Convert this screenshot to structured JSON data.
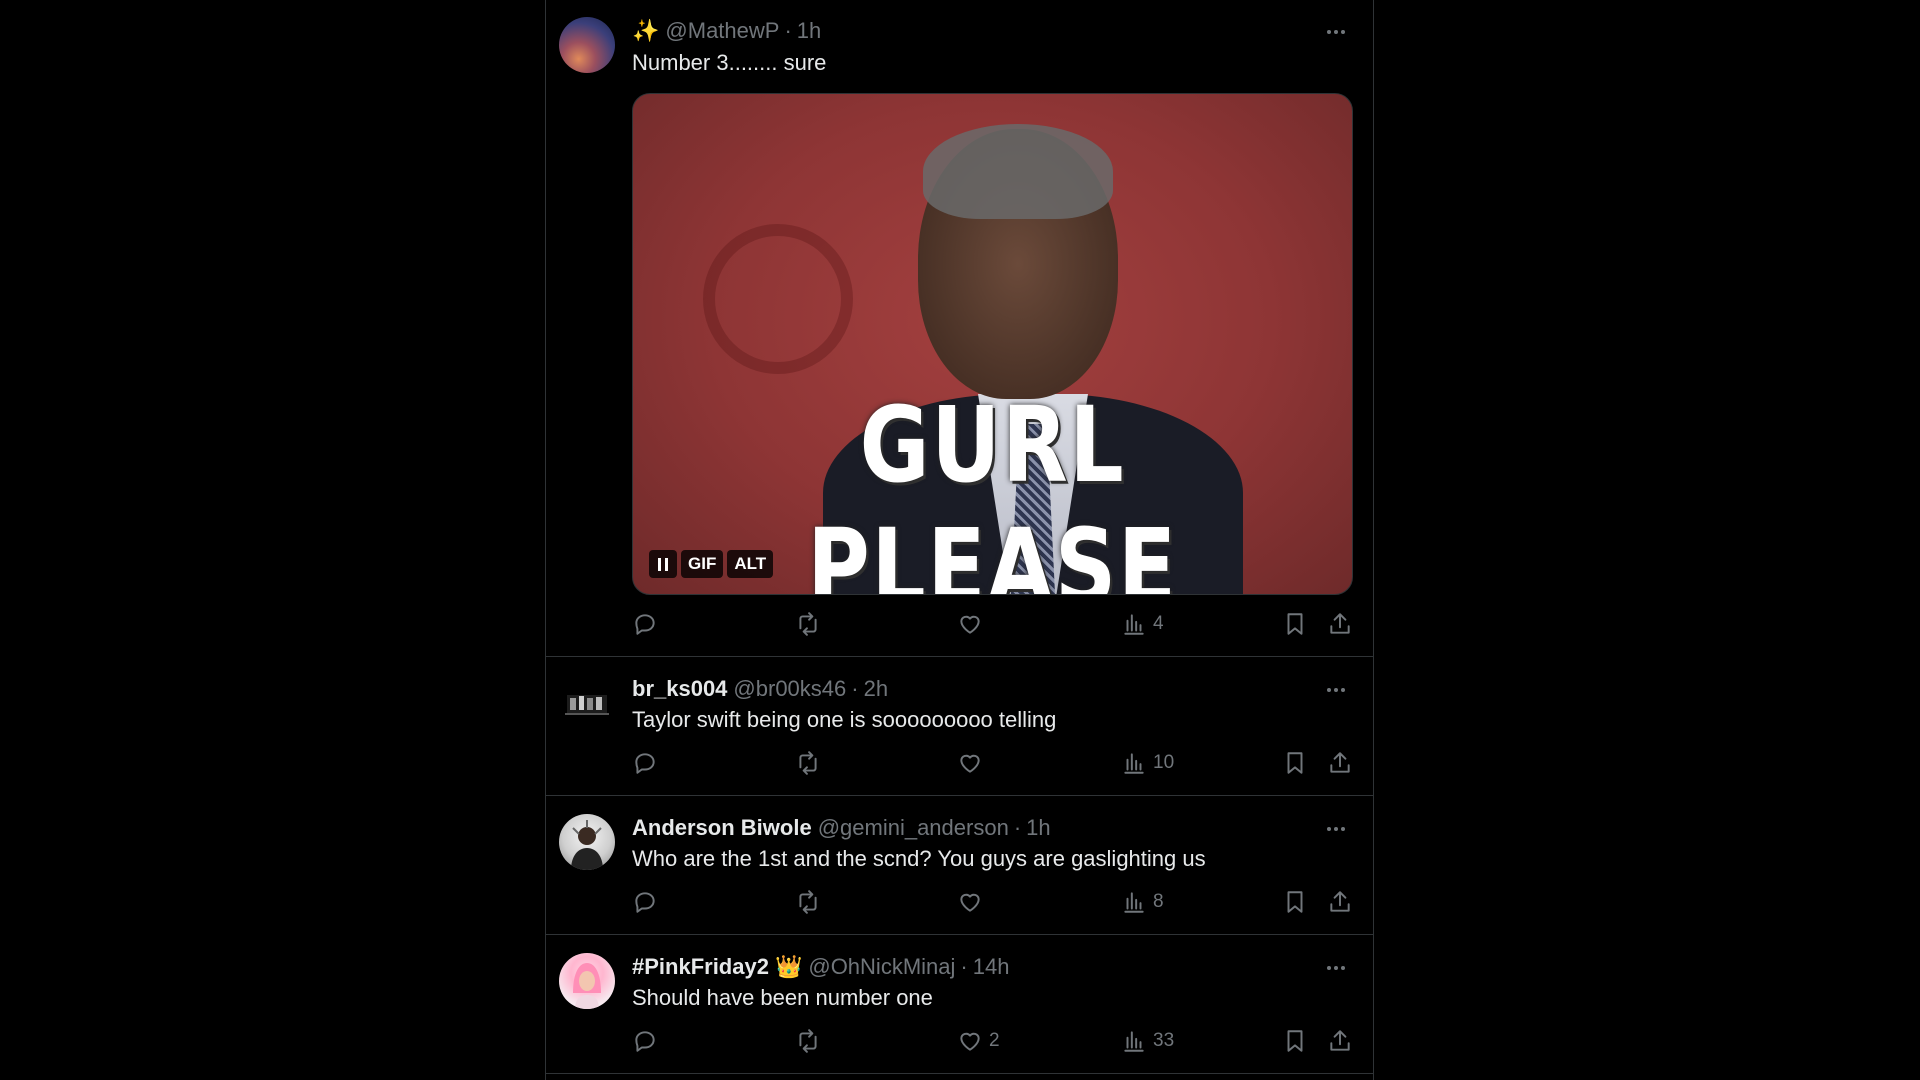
{
  "posts": [
    {
      "name": "",
      "emoji": "✨",
      "handle": "@MathewP",
      "time": "1h",
      "text": "Number 3........ sure",
      "media": {
        "caption": "GURL PLEASE",
        "badges": [
          "GIF",
          "ALT"
        ]
      },
      "likes": "",
      "views": "4"
    },
    {
      "name": "br_ks004",
      "handle": "@br00ks46",
      "time": "2h",
      "text": "Taylor swift being one is sooooooooo telling",
      "likes": "",
      "views": "10"
    },
    {
      "name": "Anderson Biwole",
      "handle": "@gemini_anderson",
      "time": "1h",
      "text": "Who are the 1st and the scnd? You guys are gaslighting us",
      "likes": "",
      "views": "8"
    },
    {
      "name": "#PinkFriday2",
      "emoji_after": "👑",
      "handle": "@OhNickMinaj",
      "time": "14h",
      "text": "Should have been number one",
      "likes": "2",
      "views": "33"
    }
  ],
  "separator": "·",
  "icons": [
    "reply-icon",
    "retweet-icon",
    "like-icon",
    "views-icon",
    "bookmark-icon",
    "share-icon",
    "more-icon",
    "pause-icon"
  ]
}
